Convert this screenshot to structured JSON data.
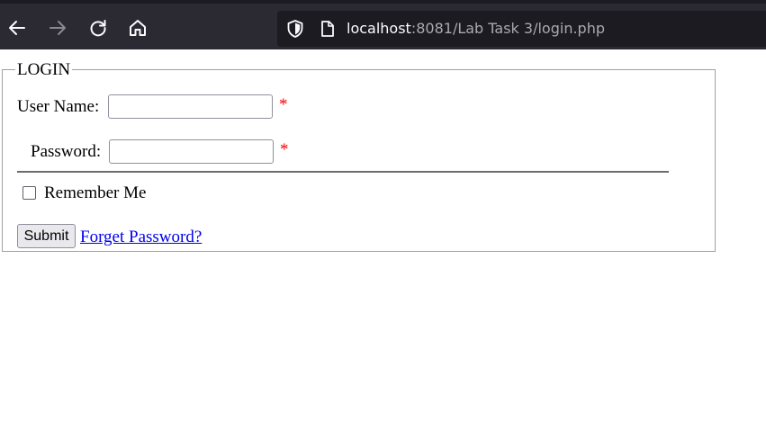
{
  "browser": {
    "url_host": "localhost",
    "url_rest": ":8081/Lab Task 3/login.php",
    "icons": {
      "back": "back-arrow-icon",
      "forward": "forward-arrow-icon",
      "reload": "reload-icon",
      "home": "home-icon",
      "security": "shield-icon",
      "page": "page-icon"
    },
    "colors": {
      "toolbar": "#2b2a33",
      "urlbar": "#1c1b22",
      "url_host": "#fbfbfe",
      "url_path": "#a9a9b3"
    }
  },
  "form": {
    "legend": "LOGIN",
    "username_label": "User Name:",
    "username_value": "",
    "password_label": "Password:",
    "password_value": "",
    "required_marker": "*",
    "remember_label": "Remember Me",
    "remember_checked": false,
    "submit_label": "Submit",
    "forget_link": "Forget Password?",
    "colors": {
      "required": "#ff0000",
      "link": "#0000ee"
    }
  }
}
